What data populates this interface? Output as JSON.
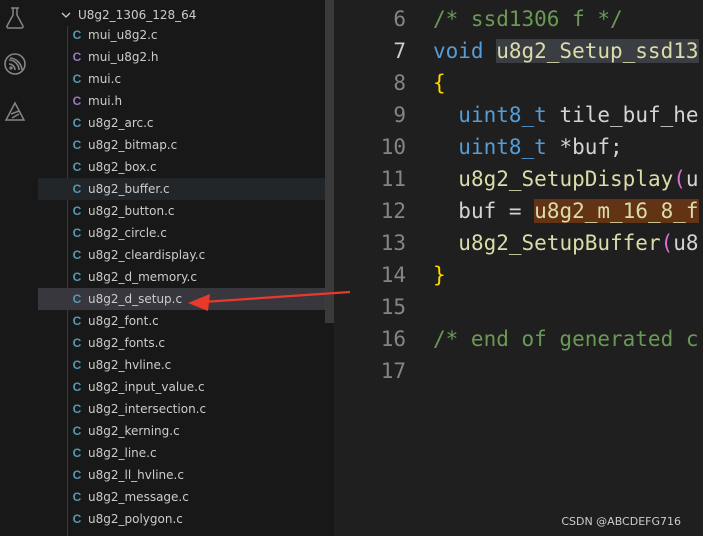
{
  "explorer": {
    "folder_name": "U8g2_1306_128_64",
    "files": [
      {
        "icon": "C",
        "name": "mui_u8g2.c",
        "type": "c"
      },
      {
        "icon": "C",
        "name": "mui_u8g2.h",
        "type": "h"
      },
      {
        "icon": "C",
        "name": "mui.c",
        "type": "c"
      },
      {
        "icon": "C",
        "name": "mui.h",
        "type": "h"
      },
      {
        "icon": "C",
        "name": "u8g2_arc.c",
        "type": "c"
      },
      {
        "icon": "C",
        "name": "u8g2_bitmap.c",
        "type": "c"
      },
      {
        "icon": "C",
        "name": "u8g2_box.c",
        "type": "c"
      },
      {
        "icon": "C",
        "name": "u8g2_buffer.c",
        "type": "c"
      },
      {
        "icon": "C",
        "name": "u8g2_button.c",
        "type": "c"
      },
      {
        "icon": "C",
        "name": "u8g2_circle.c",
        "type": "c"
      },
      {
        "icon": "C",
        "name": "u8g2_cleardisplay.c",
        "type": "c"
      },
      {
        "icon": "C",
        "name": "u8g2_d_memory.c",
        "type": "c"
      },
      {
        "icon": "C",
        "name": "u8g2_d_setup.c",
        "type": "c"
      },
      {
        "icon": "C",
        "name": "u8g2_font.c",
        "type": "c"
      },
      {
        "icon": "C",
        "name": "u8g2_fonts.c",
        "type": "c"
      },
      {
        "icon": "C",
        "name": "u8g2_hvline.c",
        "type": "c"
      },
      {
        "icon": "C",
        "name": "u8g2_input_value.c",
        "type": "c"
      },
      {
        "icon": "C",
        "name": "u8g2_intersection.c",
        "type": "c"
      },
      {
        "icon": "C",
        "name": "u8g2_kerning.c",
        "type": "c"
      },
      {
        "icon": "C",
        "name": "u8g2_line.c",
        "type": "c"
      },
      {
        "icon": "C",
        "name": "u8g2_ll_hvline.c",
        "type": "c"
      },
      {
        "icon": "C",
        "name": "u8g2_message.c",
        "type": "c"
      },
      {
        "icon": "C",
        "name": "u8g2_polygon.c",
        "type": "c"
      }
    ],
    "hovered_file": "u8g2_buffer.c",
    "selected_file": "u8g2_d_setup.c"
  },
  "colors": {
    "c_icon": "#519aba",
    "h_icon": "#a074c4",
    "arrow": "#e8392b"
  },
  "editor": {
    "current_line": "7",
    "lines": [
      {
        "n": "6",
        "parts": [
          {
            "t": "/* ssd1306 f */",
            "c": "c-comment"
          }
        ]
      },
      {
        "n": "7",
        "parts": [
          {
            "t": "void ",
            "c": "c-type"
          },
          {
            "t": "u8g2_Setup_ssd13",
            "c": "c-fn hl-sel"
          }
        ]
      },
      {
        "n": "8",
        "parts": [
          {
            "t": "{",
            "c": "c-brace"
          }
        ]
      },
      {
        "n": "9",
        "parts": [
          {
            "t": "  ",
            "c": "c-var"
          },
          {
            "t": "uint8_t",
            "c": "c-type"
          },
          {
            "t": " tile_buf_he",
            "c": "c-var"
          }
        ]
      },
      {
        "n": "10",
        "parts": [
          {
            "t": "  ",
            "c": "c-var"
          },
          {
            "t": "uint8_t",
            "c": "c-type"
          },
          {
            "t": " *buf;",
            "c": "c-var"
          }
        ]
      },
      {
        "n": "11",
        "parts": [
          {
            "t": "  ",
            "c": "c-var"
          },
          {
            "t": "u8g2_SetupDisplay",
            "c": "c-fn"
          },
          {
            "t": "(",
            "c": "c-paren"
          },
          {
            "t": "u",
            "c": "c-var"
          }
        ]
      },
      {
        "n": "12",
        "parts": [
          {
            "t": "  ",
            "c": "c-var"
          },
          {
            "t": "buf",
            "c": "c-var"
          },
          {
            "t": " = ",
            "c": "c-var"
          },
          {
            "t": "u8g2_m_16_8_f",
            "c": "c-fn hl-word"
          }
        ]
      },
      {
        "n": "13",
        "parts": [
          {
            "t": "  ",
            "c": "c-var"
          },
          {
            "t": "u8g2_SetupBuffer",
            "c": "c-fn"
          },
          {
            "t": "(",
            "c": "c-paren"
          },
          {
            "t": "u8",
            "c": "c-var"
          }
        ]
      },
      {
        "n": "14",
        "parts": [
          {
            "t": "}",
            "c": "c-brace"
          }
        ]
      },
      {
        "n": "15",
        "parts": []
      },
      {
        "n": "16",
        "parts": [
          {
            "t": "/* end of generated c",
            "c": "c-comment"
          }
        ]
      },
      {
        "n": "17",
        "parts": []
      }
    ]
  },
  "watermark": "CSDN @ABCDEFG716"
}
